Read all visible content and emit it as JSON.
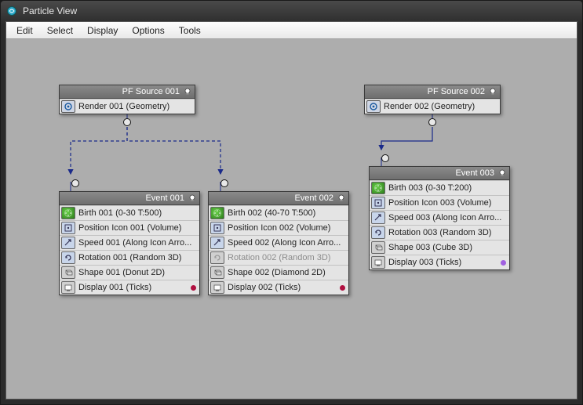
{
  "window": {
    "title": "Particle View"
  },
  "menu": {
    "edit": "Edit",
    "select": "Select",
    "display": "Display",
    "options": "Options",
    "tools": "Tools"
  },
  "nodes": {
    "src1": {
      "title": "PF Source 001",
      "render": "Render 001 (Geometry)"
    },
    "src2": {
      "title": "PF Source 002",
      "render": "Render 002 (Geometry)"
    },
    "ev1": {
      "title": "Event 001",
      "birth": "Birth 001 (0-30 T:500)",
      "pos": "Position Icon 001 (Volume)",
      "speed": "Speed 001 (Along Icon Arro...",
      "rot": "Rotation 001 (Random 3D)",
      "shape": "Shape 001 (Donut 2D)",
      "display": "Display 001 (Ticks)"
    },
    "ev2": {
      "title": "Event 002",
      "birth": "Birth 002 (40-70 T:500)",
      "pos": "Position Icon 002 (Volume)",
      "speed": "Speed 002 (Along Icon Arro...",
      "rot": "Rotation 002 (Random 3D)",
      "shape": "Shape 002 (Diamond 2D)",
      "display": "Display 002 (Ticks)"
    },
    "ev3": {
      "title": "Event 003",
      "birth": "Birth 003 (0-30 T:200)",
      "pos": "Position Icon 003 (Volume)",
      "speed": "Speed 003 (Along Icon Arro...",
      "rot": "Rotation 003 (Random 3D)",
      "shape": "Shape 003 (Cube 3D)",
      "display": "Display 003 (Ticks)"
    }
  }
}
